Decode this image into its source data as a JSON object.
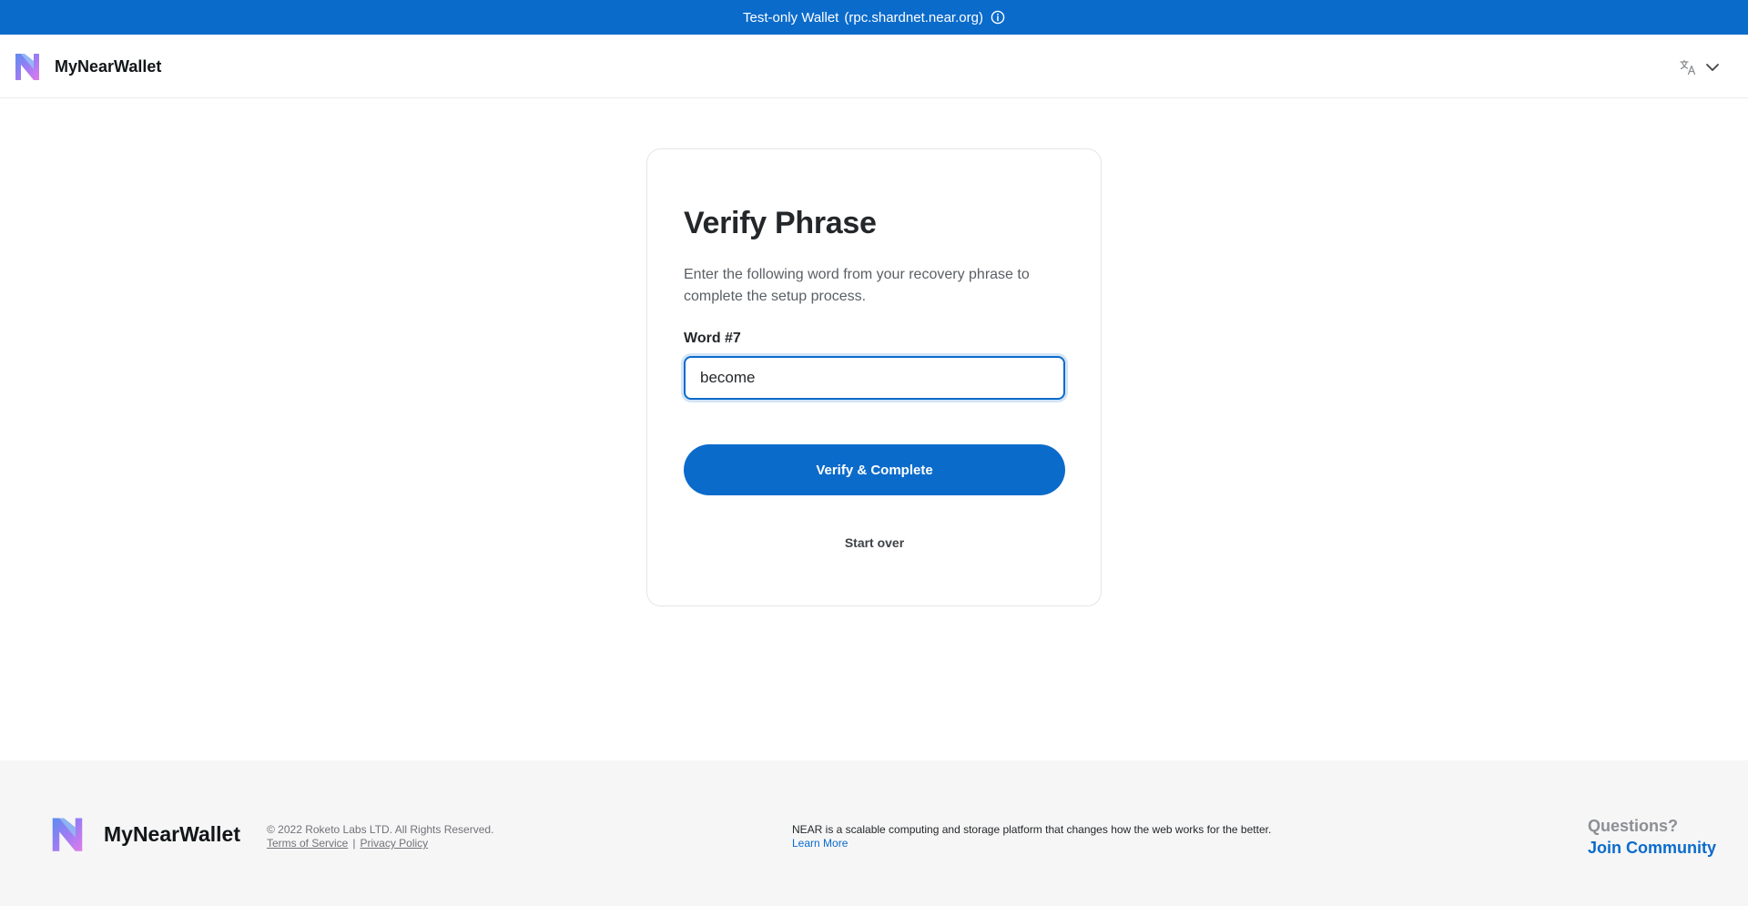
{
  "banner": {
    "label": "Test-only Wallet",
    "network": "(rpc.shardnet.near.org)",
    "info_icon": "info-circle-icon",
    "bg_color": "#0b6bcb"
  },
  "header": {
    "brand_name": "MyNearWallet",
    "logo_icon": "mynearwallet-logo-icon",
    "language_icon": "translate-icon",
    "language_dropdown_icon": "chevron-down-icon"
  },
  "verify": {
    "title": "Verify Phrase",
    "description": "Enter the following word from your recovery phrase to complete the setup process.",
    "field_label": "Word #7",
    "input_value": "become",
    "submit_label": "Verify & Complete",
    "start_over_label": "Start over",
    "accent_color": "#0b6bcb"
  },
  "footer": {
    "brand_name": "MyNearWallet",
    "copyright": "© 2022 Roketo Labs LTD. All Rights Reserved.",
    "terms_label": "Terms of Service",
    "divider": "|",
    "privacy_label": "Privacy Policy",
    "about_text": "NEAR is a scalable computing and storage platform that changes how the web works for the better.",
    "learn_more_label": "Learn More",
    "questions_label": "Questions?",
    "community_label": "Join Community"
  }
}
